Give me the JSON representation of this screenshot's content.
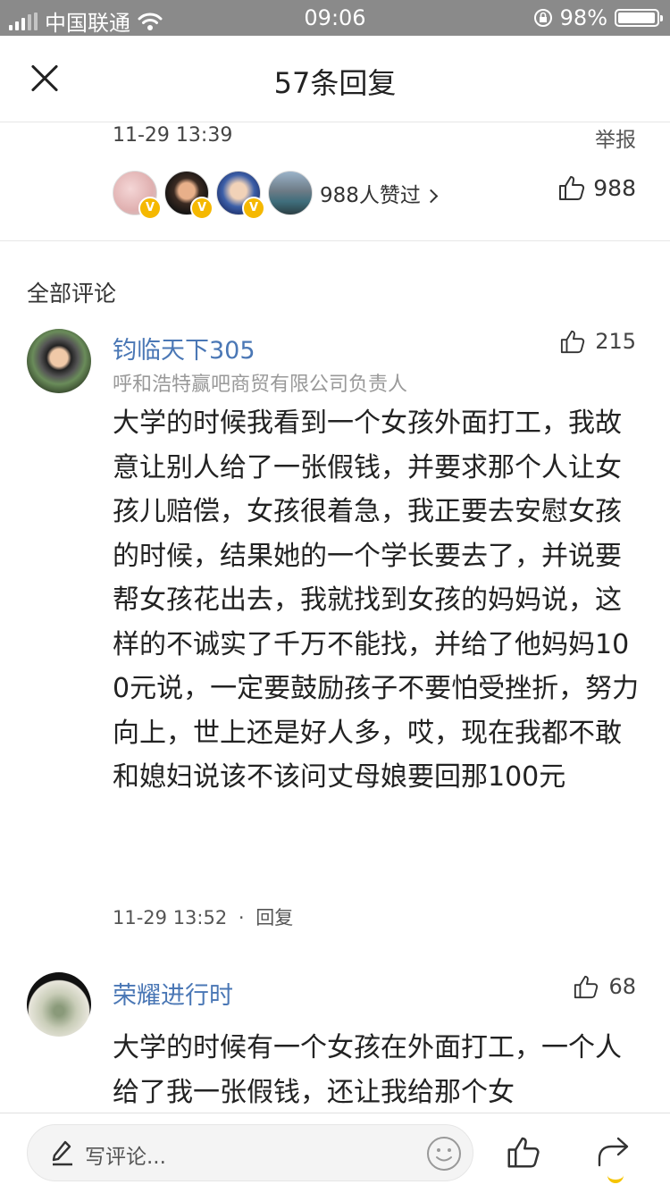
{
  "status_bar": {
    "carrier": "中国联通",
    "time": "09:06",
    "battery_percent": "98%",
    "battery_level": 0.98
  },
  "nav": {
    "title": "57条回复",
    "close_icon": "close-icon"
  },
  "post": {
    "date": "11-29 13:39",
    "report_label": "举报",
    "likers_text": "988人赞过",
    "like_count": "988"
  },
  "section_title": "全部评论",
  "comments": [
    {
      "name": "钧临天下305",
      "subtitle": "呼和浩特赢吧商贸有限公司负责人",
      "likes": "215",
      "text": "大学的时候我看到一个女孩外面打工，我故意让别人给了一张假钱，并要求那个人让女孩儿赔偿，女孩很着急，我正要去安慰女孩的时候，结果她的一个学长要去了，并说要帮女孩花出去，我就找到女孩的妈妈说，这样的不诚实了千万不能找，并给了他妈妈100元说，一定要鼓励孩子不要怕受挫折，努力向上，世上还是好人多，哎，现在我都不敢和媳妇说该不该问丈母娘要回那100元",
      "time": "11-29 13:52",
      "separator": "·",
      "reply_label": "回复"
    },
    {
      "name": "荣耀进行时",
      "likes": "68",
      "text": "大学的时候有一个女孩在外面打工，一个人给了我一张假钱，还让我给那个女"
    }
  ],
  "bottom_bar": {
    "placeholder": "写评论...",
    "pen_icon": "pen-icon",
    "emoji_icon": "smile-icon",
    "like_icon": "thumbs-up-icon",
    "share_icon": "share-icon"
  },
  "colors": {
    "status_bar_bg": "#8a8a8a",
    "username": "#4a77b5",
    "verified_badge": "#f5b800",
    "muted_text": "#999999"
  }
}
